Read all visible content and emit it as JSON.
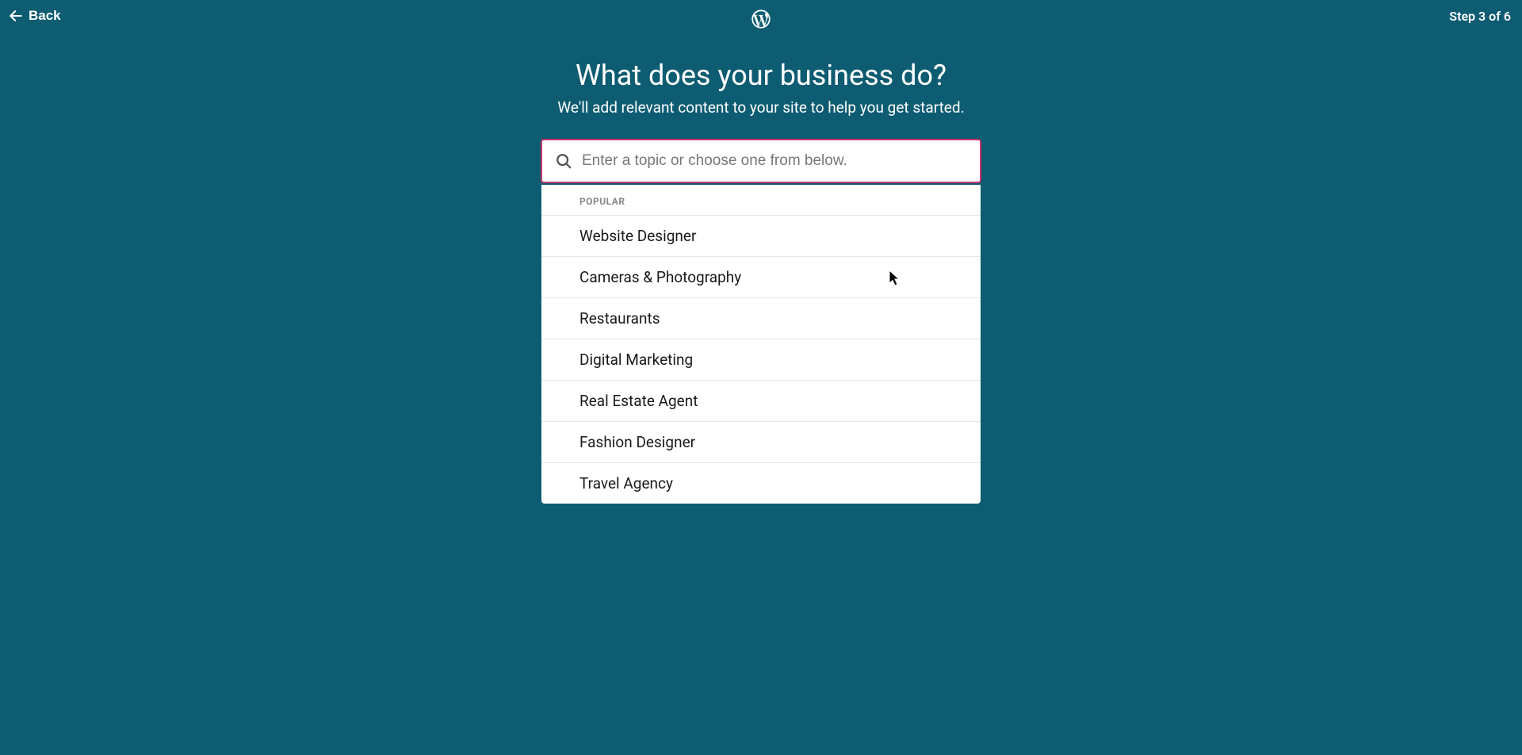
{
  "header": {
    "back_label": "Back",
    "step_label": "Step 3 of 6"
  },
  "main": {
    "title": "What does your business do?",
    "subtitle": "We'll add relevant content to your site to help you get started.",
    "search_placeholder": "Enter a topic or choose one from below."
  },
  "dropdown": {
    "section_label": "POPULAR",
    "options": [
      "Website Designer",
      "Cameras & Photography",
      "Restaurants",
      "Digital Marketing",
      "Real Estate Agent",
      "Fashion Designer",
      "Travel Agency"
    ]
  }
}
